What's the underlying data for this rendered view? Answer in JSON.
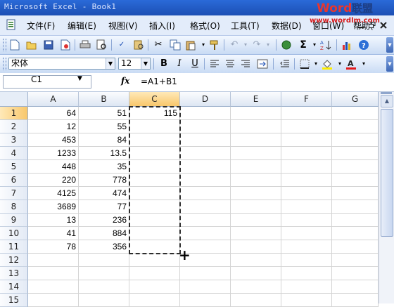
{
  "window": {
    "title": "Microsoft Excel - Book1"
  },
  "watermark": {
    "logo": "Word联盟",
    "url": "www.wordlm.com"
  },
  "menu": {
    "items": [
      "文件(F)",
      "编辑(E)",
      "视图(V)",
      "插入(I)",
      "格式(O)",
      "工具(T)",
      "数据(D)",
      "窗口(W)",
      "帮助(H)"
    ]
  },
  "format_toolbar": {
    "font_name": "宋体",
    "font_size": "12",
    "bold": "B",
    "italic": "I",
    "underline": "U"
  },
  "formula_bar": {
    "name_box": "C1",
    "fx": "fx",
    "formula": "=A1+B1"
  },
  "sheet": {
    "columns": [
      "A",
      "B",
      "C",
      "D",
      "E",
      "F",
      "G"
    ],
    "active_column": "C",
    "active_row": "1",
    "rows": [
      {
        "row": "1",
        "A": "64",
        "B": "51",
        "C": "115"
      },
      {
        "row": "2",
        "A": "12",
        "B": "55",
        "C": ""
      },
      {
        "row": "3",
        "A": "453",
        "B": "84",
        "C": ""
      },
      {
        "row": "4",
        "A": "1233",
        "B": "13.5",
        "C": ""
      },
      {
        "row": "5",
        "A": "448",
        "B": "35",
        "C": ""
      },
      {
        "row": "6",
        "A": "220",
        "B": "778",
        "C": ""
      },
      {
        "row": "7",
        "A": "4125",
        "B": "474",
        "C": ""
      },
      {
        "row": "8",
        "A": "3689",
        "B": "77",
        "C": ""
      },
      {
        "row": "9",
        "A": "13",
        "B": "236",
        "C": ""
      },
      {
        "row": "10",
        "A": "41",
        "B": "884",
        "C": ""
      },
      {
        "row": "11",
        "A": "78",
        "B": "356",
        "C": ""
      },
      {
        "row": "12",
        "A": "",
        "B": "",
        "C": ""
      },
      {
        "row": "13",
        "A": "",
        "B": "",
        "C": ""
      },
      {
        "row": "14",
        "A": "",
        "B": "",
        "C": ""
      },
      {
        "row": "15",
        "A": "",
        "B": "",
        "C": ""
      }
    ]
  },
  "icons": {
    "standard": [
      "new-icon",
      "open-icon",
      "save-icon",
      "permission-icon",
      "print-icon",
      "print-preview-icon",
      "spelling-icon",
      "research-icon",
      "cut-icon",
      "copy-icon",
      "paste-icon",
      "format-painter-icon",
      "undo-icon",
      "redo-icon",
      "hyperlink-icon",
      "autosum-icon",
      "sort-ascending-icon",
      "chart-wizard-icon",
      "help-icon"
    ],
    "formatting": [
      "bold-icon",
      "italic-icon",
      "underline-icon",
      "align-left-icon",
      "center-icon",
      "align-right-icon",
      "merge-center-icon",
      "decrease-indent-icon",
      "borders-icon",
      "fill-color-icon",
      "font-color-icon"
    ]
  },
  "colors": {
    "title_bar": "#1c4fb4",
    "menu_bg": "#e3ecfa",
    "active_header": "#f8c76b",
    "watermark_red": "#d61a1a"
  }
}
